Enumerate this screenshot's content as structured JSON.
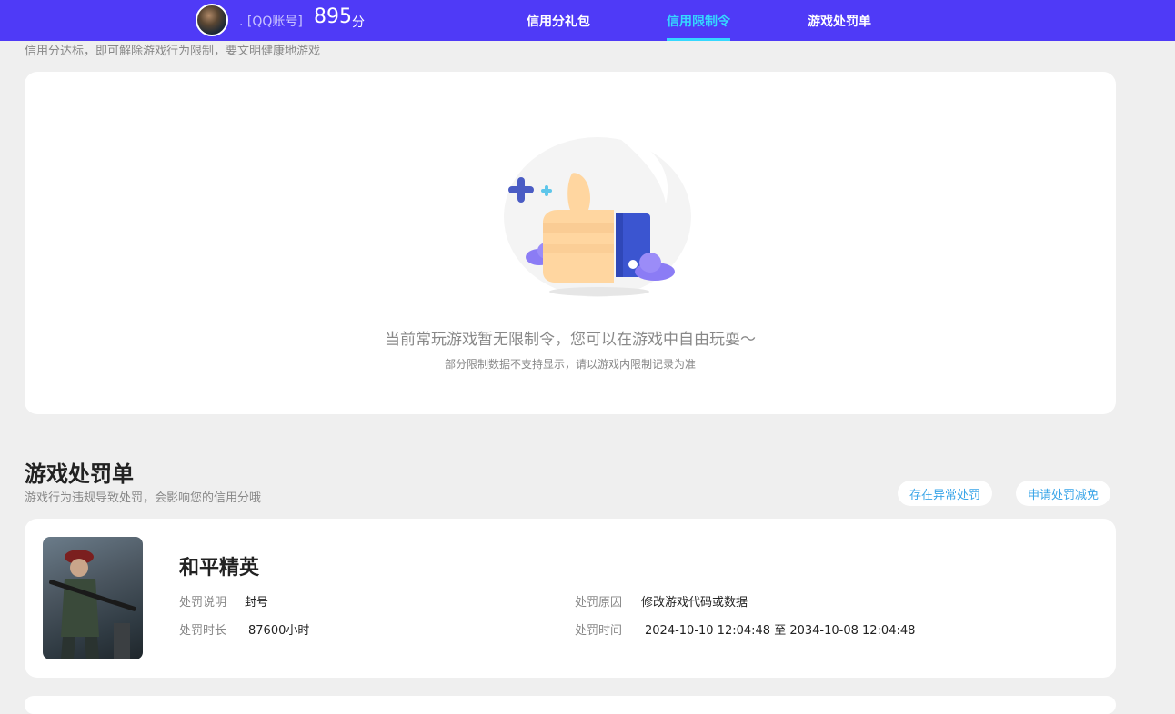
{
  "header": {
    "account_label": ". [QQ账号]",
    "score": "895",
    "score_unit": "分",
    "tabs": [
      {
        "label": "信用分礼包",
        "active": false
      },
      {
        "label": "信用限制令",
        "active": true
      },
      {
        "label": "游戏处罚单",
        "active": false
      }
    ],
    "accent_color": "#4f3af7",
    "active_color": "#35d8ff"
  },
  "restriction": {
    "hint": "信用分达标，即可解除游戏行为限制，要文明健康地游戏",
    "empty_title": "当前常玩游戏暂无限制令，您可以在游戏中自由玩耍～",
    "empty_sub": "部分限制数据不支持显示，请以游戏内限制记录为准",
    "illustration_icon": "thumbs-up-icon"
  },
  "penalty_section": {
    "title": "游戏处罚单",
    "subtitle": "游戏行为违规导致处罚，会影响您的信用分哦",
    "buttons": {
      "appeal_abnormal": "存在异常处罚",
      "apply_reduction": "申请处罚减免"
    },
    "items": [
      {
        "game": "和平精英",
        "desc_label": "处罚说明",
        "desc_value": "封号",
        "reason_label": "处罚原因",
        "reason_value": "修改游戏代码或数据",
        "duration_label": "处罚时长",
        "duration_value": "87600小时",
        "time_label": "处罚时间",
        "time_value": "2024-10-10 12:04:48 至 2034-10-08 12:04:48"
      }
    ]
  }
}
